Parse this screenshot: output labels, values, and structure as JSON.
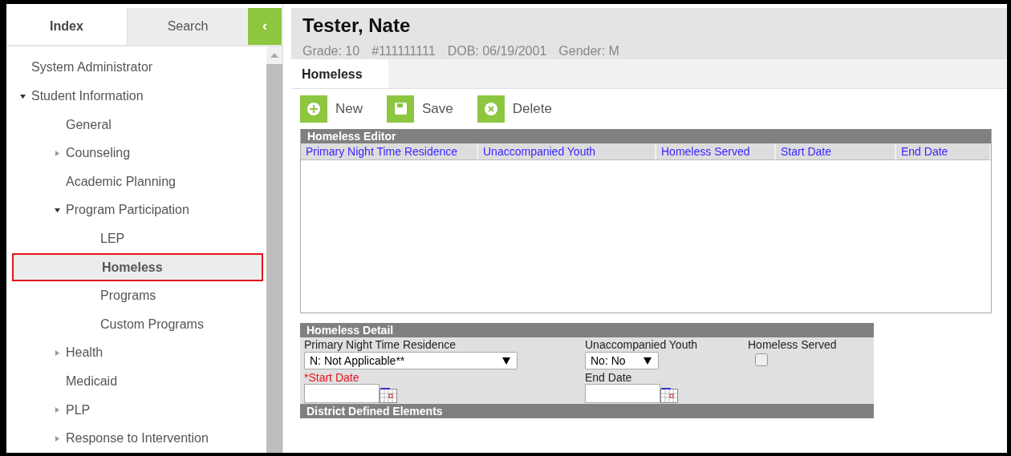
{
  "sidebar": {
    "tabs": [
      {
        "label": "Index",
        "selected": true
      },
      {
        "label": "Search",
        "selected": false
      }
    ],
    "collapse_button": "‹",
    "tree": [
      {
        "label": "System Administrator",
        "kind": "leaf",
        "selected": false
      },
      {
        "label": "Student Information",
        "kind": "folder",
        "expanded": true,
        "selected": false,
        "children": [
          {
            "label": "General",
            "kind": "leaf",
            "selected": false
          },
          {
            "label": "Counseling",
            "kind": "folder",
            "expanded": false,
            "selected": false
          },
          {
            "label": "Academic Planning",
            "kind": "leaf",
            "selected": false
          },
          {
            "label": "Program Participation",
            "kind": "folder",
            "expanded": true,
            "selected": false,
            "children": [
              {
                "label": "LEP",
                "kind": "leaf",
                "selected": false
              },
              {
                "label": "Homeless",
                "kind": "leaf",
                "selected": true
              },
              {
                "label": "Programs",
                "kind": "leaf",
                "selected": false
              },
              {
                "label": "Custom Programs",
                "kind": "leaf",
                "selected": false
              }
            ]
          },
          {
            "label": "Health",
            "kind": "folder",
            "expanded": false,
            "selected": false
          },
          {
            "label": "Medicaid",
            "kind": "leaf",
            "selected": false
          },
          {
            "label": "PLP",
            "kind": "folder",
            "expanded": false,
            "selected": false
          },
          {
            "label": "Response to Intervention",
            "kind": "folder",
            "expanded": false,
            "selected": false
          }
        ]
      }
    ]
  },
  "header": {
    "name": "Tester, Nate",
    "info": [
      "Grade: 10",
      "#111111111",
      "DOB: 06/19/2001",
      "Gender: M"
    ]
  },
  "tabs": [
    {
      "label": "Homeless",
      "selected": true
    }
  ],
  "actions": [
    {
      "label": "New",
      "kind": "new"
    },
    {
      "label": "Save",
      "kind": "save"
    },
    {
      "label": "Delete",
      "kind": "delete"
    }
  ],
  "editor": {
    "title": "Homeless Editor",
    "columns": [
      "Primary Night Time Residence",
      "Unaccompanied Youth",
      "Homeless Served",
      "Start Date",
      "End Date"
    ]
  },
  "detail": {
    "title": "Homeless Detail",
    "fields": [
      {
        "label": "Primary Night Time Residence",
        "kind": "select",
        "value": "N: Not Applicable**",
        "required": false
      },
      {
        "label": "Unaccompanied Youth",
        "kind": "select",
        "value": "No: No",
        "required": false
      },
      {
        "label": "Homeless Served",
        "kind": "checkbox",
        "checked": false,
        "required": false
      },
      {
        "label": "*Start Date",
        "kind": "date",
        "required": true
      },
      {
        "label": "End Date",
        "kind": "date",
        "required": false
      }
    ],
    "footer": "District Defined Elements"
  }
}
